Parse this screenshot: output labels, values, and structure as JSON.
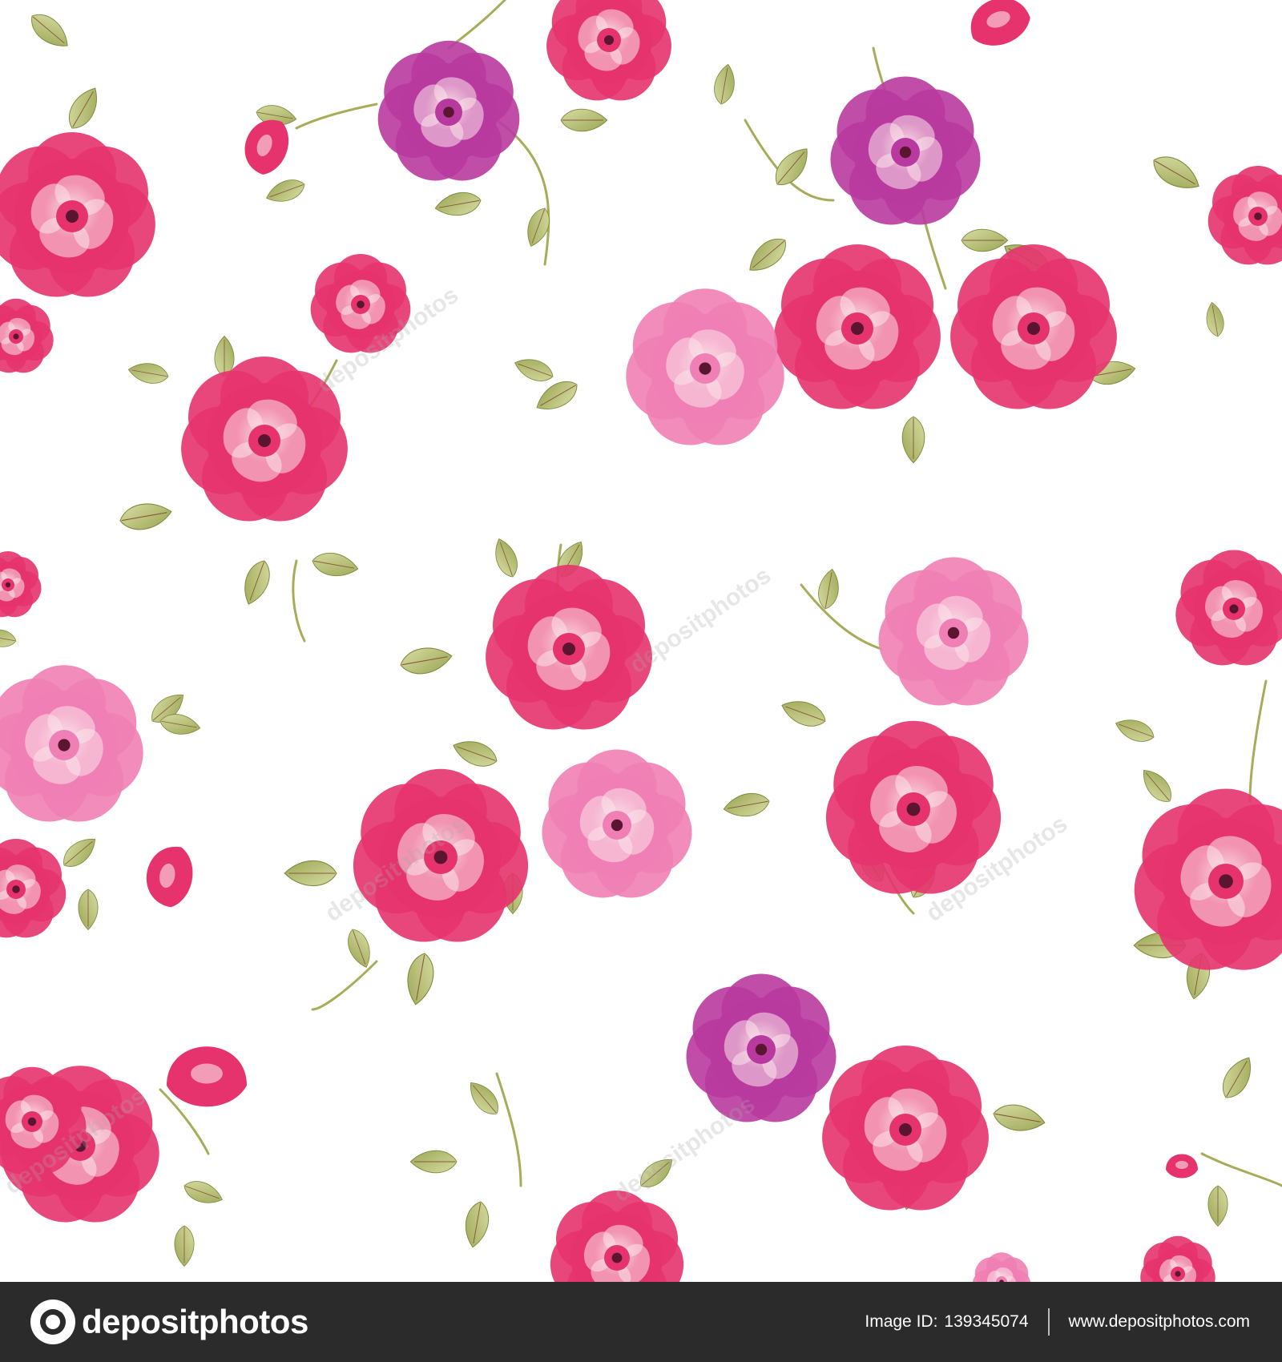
{
  "image": {
    "description_free": true,
    "colors": {
      "background": "#ffffff",
      "rose_red": "#e6336e",
      "rose_pink": "#ef7fb4",
      "rose_purple": "#b93a9f",
      "rose_highlight": "#fbe3ea",
      "leaf": "#9ba654",
      "leaf_light": "#d8dca3",
      "footer_bg": "#2b2b2b"
    },
    "watermark": "depositphotos"
  },
  "footer": {
    "logo_text": "depositphotos",
    "image_id_label": "Image ID:",
    "image_id": "139345074",
    "site_url": "www.depositphotos.com"
  }
}
